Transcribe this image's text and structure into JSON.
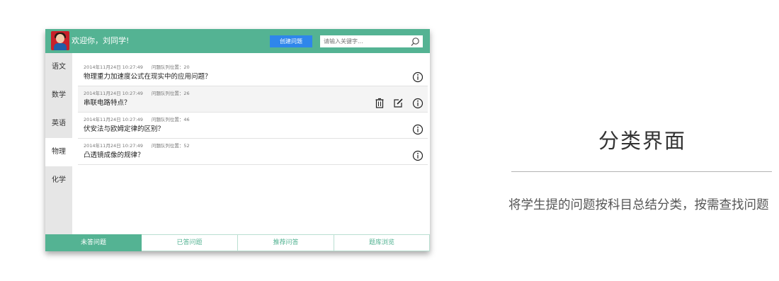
{
  "header": {
    "welcome": "欢迎你，刘同学!",
    "create_label": "创建问题",
    "search_placeholder": "请输入关键字..."
  },
  "sidebar": {
    "items": [
      {
        "label": "语文"
      },
      {
        "label": "数学"
      },
      {
        "label": "英语"
      },
      {
        "label": "物理"
      },
      {
        "label": "化学"
      }
    ],
    "selected": "物理"
  },
  "questions": [
    {
      "date": "2014年11月24日 10:27:49",
      "position": "问题队列位置：20",
      "title": "物理重力加速度公式在现实中的应用问题？"
    },
    {
      "date": "2014年11月24日 10:27:49",
      "position": "问题队列位置：26",
      "title": "串联电路特点？"
    },
    {
      "date": "2014年11月24日 10:27:49",
      "position": "问题队列位置：46",
      "title": "伏安法与欧姆定律的区别？"
    },
    {
      "date": "2014年11月24日 10:27:49",
      "position": "问题队列位置：52",
      "title": "凸透镜成像的规律？"
    }
  ],
  "tabs": [
    {
      "label": "未答问题"
    },
    {
      "label": "已答问题"
    },
    {
      "label": "推荐问答"
    },
    {
      "label": "题库浏览"
    }
  ],
  "active_tab": "未答问题",
  "panel": {
    "title": "分类界面",
    "description": "将学生提的问题按科目总结分类，按需查找问题"
  },
  "colors": {
    "accent": "#54b393",
    "button": "#2f86eb"
  },
  "icons": {
    "delete": "trash-icon",
    "edit": "edit-icon",
    "info": "info-icon",
    "search": "search-icon"
  }
}
